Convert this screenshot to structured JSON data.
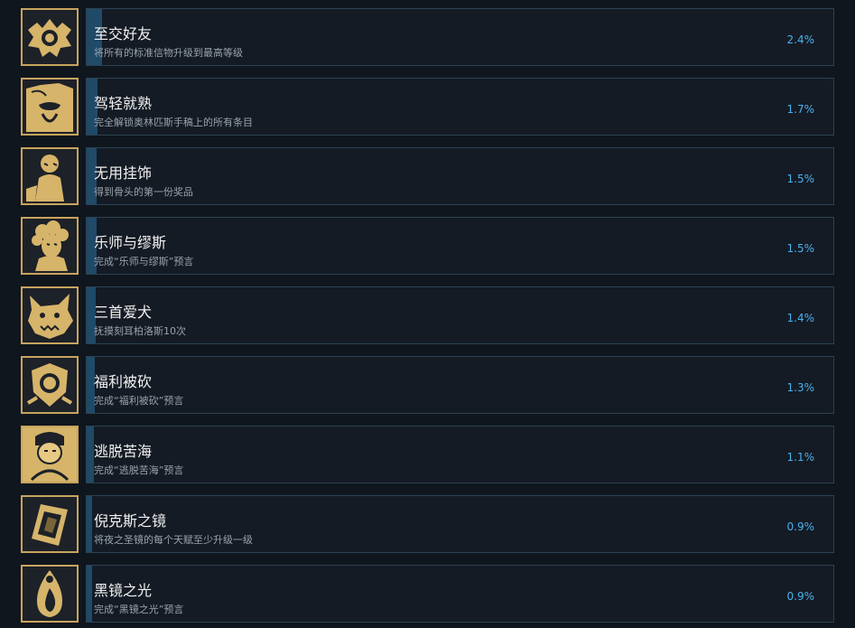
{
  "colors": {
    "background": "#10161e",
    "panel": "#141b24",
    "panel_border": "#2c4253",
    "progress_fill": "#1f4a68",
    "title_text": "#f2f2f2",
    "description_text": "#9aa2ab",
    "percent_text": "#4bb1f0",
    "icon_gold": "#d6b46a"
  },
  "achievements": [
    {
      "title": "至交好友",
      "description": "将所有的标准信物升级到最高等级",
      "percent": "2.4%",
      "unlock_rate": 2.4,
      "icon": "winged-orb-emblem-icon"
    },
    {
      "title": "驾轻就熟",
      "description": "完全解锁奥林匹斯手稿上的所有条目",
      "percent": "1.7%",
      "unlock_rate": 1.7,
      "icon": "bearded-old-god-icon"
    },
    {
      "title": "无用挂饰",
      "description": "得到骨头的第一份奖品",
      "percent": "1.5%",
      "unlock_rate": 1.5,
      "icon": "seated-figure-icon"
    },
    {
      "title": "乐师与缪斯",
      "description": "完成“乐师与缪斯”预言",
      "percent": "1.5%",
      "unlock_rate": 1.5,
      "icon": "curly-haired-musician-icon"
    },
    {
      "title": "三首爱犬",
      "description": "抚摸刻耳柏洛斯10次",
      "percent": "1.4%",
      "unlock_rate": 1.4,
      "icon": "hound-head-icon"
    },
    {
      "title": "福利被砍",
      "description": "完成“福利被砍”预言",
      "percent": "1.3%",
      "unlock_rate": 1.3,
      "icon": "chained-shield-icon"
    },
    {
      "title": "逃脱苦海",
      "description": "完成“逃脱苦海”预言",
      "percent": "1.1%",
      "unlock_rate": 1.1,
      "icon": "weary-hero-icon"
    },
    {
      "title": "倪克斯之镜",
      "description": "将夜之圣镜的每个天赋至少升级一级",
      "percent": "0.9%",
      "unlock_rate": 0.9,
      "icon": "ornate-mirror-icon"
    },
    {
      "title": "黑镜之光",
      "description": "完成“黑镜之光”预言",
      "percent": "0.9%",
      "unlock_rate": 0.9,
      "icon": "flame-drop-icon"
    }
  ]
}
